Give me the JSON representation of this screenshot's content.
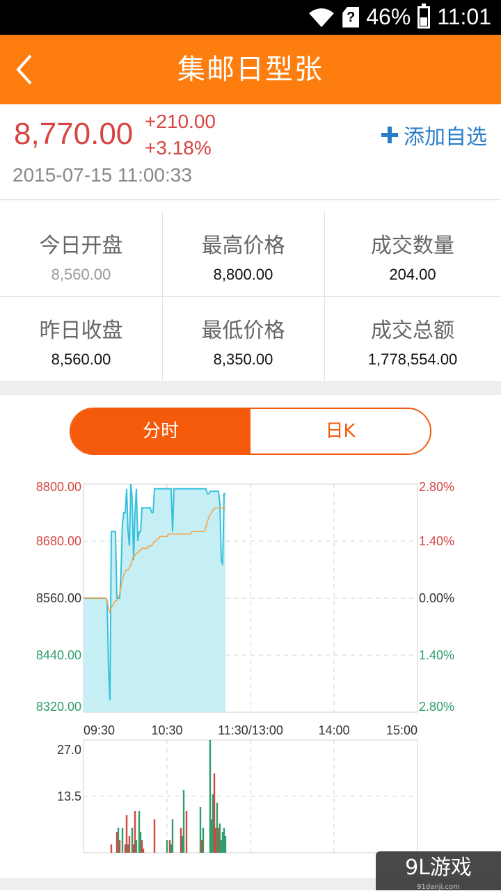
{
  "status_bar": {
    "battery": "46%",
    "time": "11:01",
    "sim_glyph": "?"
  },
  "header": {
    "title": "集邮日型张",
    "back_icon": "chevron-left-icon"
  },
  "quote": {
    "price": "8,770.00",
    "change": "+210.00",
    "change_pct": "+3.18%",
    "timestamp": "2015-07-15 11:00:33",
    "add_watch_label": "添加自选"
  },
  "stats": [
    {
      "label": "今日开盘",
      "value": "8,560.00",
      "muted": true
    },
    {
      "label": "最高价格",
      "value": "8,800.00"
    },
    {
      "label": "成交数量",
      "value": "204.00"
    },
    {
      "label": "昨日收盘",
      "value": "8,560.00"
    },
    {
      "label": "最低价格",
      "value": "8,350.00"
    },
    {
      "label": "成交总额",
      "value": "1,778,554.00"
    }
  ],
  "tabs": {
    "intraday": "分时",
    "daily_k": "日K",
    "active": "intraday"
  },
  "colors": {
    "accent": "#fd7d0f",
    "up": "#d64541",
    "down": "#2e9e6b",
    "fill": "#c6eef5",
    "price_line": "#36c0dc",
    "avg_line": "#f2a344"
  },
  "chart_data": {
    "type": "line",
    "title": "",
    "xlabel": "",
    "ylabel": "",
    "x_ticks": [
      "09:30",
      "10:30",
      "11:30/13:00",
      "14:00",
      "15:00"
    ],
    "y_ticks_left": [
      "8800.00",
      "8680.00",
      "8560.00",
      "8440.00",
      "8320.00"
    ],
    "y_ticks_right": [
      "2.80%",
      "1.40%",
      "0.00%",
      "1.40%",
      "2.80%"
    ],
    "ylim": [
      8320,
      8800
    ],
    "series": [
      {
        "values": [
          8560,
          8560,
          8560,
          8560,
          8560,
          8560,
          8560,
          8560,
          8560,
          8560,
          8560,
          8560,
          8560,
          8560,
          8560,
          8560,
          8560,
          8555,
          8410,
          8345,
          8700,
          8700,
          8700,
          8700,
          8560,
          8560,
          8560,
          8620,
          8720,
          8740,
          8740,
          8790,
          8700,
          8670,
          8800,
          8770,
          8640,
          8740,
          8790,
          8680,
          8700,
          8700,
          8750,
          8750,
          8750,
          8750,
          8750,
          8750,
          8750,
          8740,
          8740,
          8790,
          8790,
          8790,
          8790,
          8790,
          8790,
          8790,
          8790,
          8790,
          8790,
          8790,
          8790,
          8790,
          8700,
          8790,
          8790,
          8790,
          8790,
          8790,
          8790,
          8790,
          8790,
          8790,
          8790,
          8790,
          8790,
          8790,
          8790,
          8790,
          8790,
          8790,
          8790,
          8790,
          8790,
          8790,
          8790,
          8790,
          8790,
          8780,
          8780,
          8785,
          8785,
          8785,
          8785,
          8785,
          8785,
          8785,
          8760,
          8640,
          8630,
          8780,
          8780
        ]
      },
      {
        "values": [
          8560,
          8560,
          8560,
          8560,
          8560,
          8560,
          8560,
          8560,
          8560,
          8560,
          8560,
          8560,
          8560,
          8560,
          8560,
          8560,
          8560,
          8555,
          8540,
          8530,
          8540,
          8545,
          8550,
          8555,
          8555,
          8560,
          8570,
          8585,
          8600,
          8610,
          8615,
          8620,
          8620,
          8625,
          8630,
          8640,
          8650,
          8650,
          8655,
          8655,
          8660,
          8660,
          8665,
          8665,
          8665,
          8665,
          8665,
          8670,
          8670,
          8670,
          8675,
          8680,
          8680,
          8685,
          8685,
          8690,
          8690,
          8690,
          8690,
          8690,
          8690,
          8695,
          8695,
          8695,
          8695,
          8695,
          8695,
          8695,
          8695,
          8695,
          8695,
          8695,
          8695,
          8695,
          8695,
          8695,
          8695,
          8695,
          8700,
          8700,
          8700,
          8700,
          8700,
          8700,
          8700,
          8700,
          8700,
          8700,
          8710,
          8720,
          8730,
          8735,
          8740,
          8745,
          8748,
          8750,
          8750,
          8750,
          8750,
          8750,
          8750,
          8750,
          8750
        ]
      }
    ],
    "volume": {
      "ylim": [
        0,
        27
      ],
      "y_ticks": [
        "27.0",
        "13.5"
      ],
      "bars": [
        {
          "i": 20,
          "v": 2,
          "c": "up"
        },
        {
          "i": 24,
          "v": 5,
          "c": "up"
        },
        {
          "i": 25,
          "v": 6,
          "c": "down"
        },
        {
          "i": 26,
          "v": 3,
          "c": "up"
        },
        {
          "i": 28,
          "v": 6,
          "c": "down"
        },
        {
          "i": 30,
          "v": 2,
          "c": "up"
        },
        {
          "i": 31,
          "v": 9,
          "c": "up"
        },
        {
          "i": 32,
          "v": 2,
          "c": "down"
        },
        {
          "i": 33,
          "v": 4,
          "c": "up"
        },
        {
          "i": 35,
          "v": 6,
          "c": "down"
        },
        {
          "i": 36,
          "v": 2,
          "c": "up"
        },
        {
          "i": 37,
          "v": 10,
          "c": "up"
        },
        {
          "i": 38,
          "v": 3,
          "c": "down"
        },
        {
          "i": 40,
          "v": 10,
          "c": "down"
        },
        {
          "i": 41,
          "v": 5,
          "c": "down"
        },
        {
          "i": 42,
          "v": 3,
          "c": "up"
        },
        {
          "i": 43,
          "v": 1,
          "c": "up"
        },
        {
          "i": 51,
          "v": 8,
          "c": "up"
        },
        {
          "i": 60,
          "v": 3,
          "c": "down"
        },
        {
          "i": 62,
          "v": 3,
          "c": "up"
        },
        {
          "i": 63,
          "v": 2,
          "c": "down"
        },
        {
          "i": 64,
          "v": 8,
          "c": "down"
        },
        {
          "i": 70,
          "v": 6,
          "c": "up"
        },
        {
          "i": 71,
          "v": 4,
          "c": "down"
        },
        {
          "i": 72,
          "v": 15,
          "c": "down"
        },
        {
          "i": 74,
          "v": 10,
          "c": "up"
        },
        {
          "i": 84,
          "v": 11,
          "c": "down"
        },
        {
          "i": 85,
          "v": 3,
          "c": "up"
        },
        {
          "i": 86,
          "v": 6,
          "c": "down"
        },
        {
          "i": 91,
          "v": 27,
          "c": "down"
        },
        {
          "i": 92,
          "v": 8,
          "c": "down"
        },
        {
          "i": 93,
          "v": 14,
          "c": "down"
        },
        {
          "i": 94,
          "v": 19,
          "c": "up"
        },
        {
          "i": 95,
          "v": 6,
          "c": "up"
        },
        {
          "i": 96,
          "v": 12,
          "c": "down"
        },
        {
          "i": 97,
          "v": 6,
          "c": "up"
        },
        {
          "i": 98,
          "v": 7,
          "c": "down"
        },
        {
          "i": 99,
          "v": 3,
          "c": "down"
        },
        {
          "i": 100,
          "v": 5,
          "c": "down"
        },
        {
          "i": 101,
          "v": 6,
          "c": "down"
        },
        {
          "i": 102,
          "v": 4,
          "c": "down"
        }
      ]
    }
  },
  "watermark": {
    "brand": "9L游戏",
    "domain": "91danji.com"
  }
}
